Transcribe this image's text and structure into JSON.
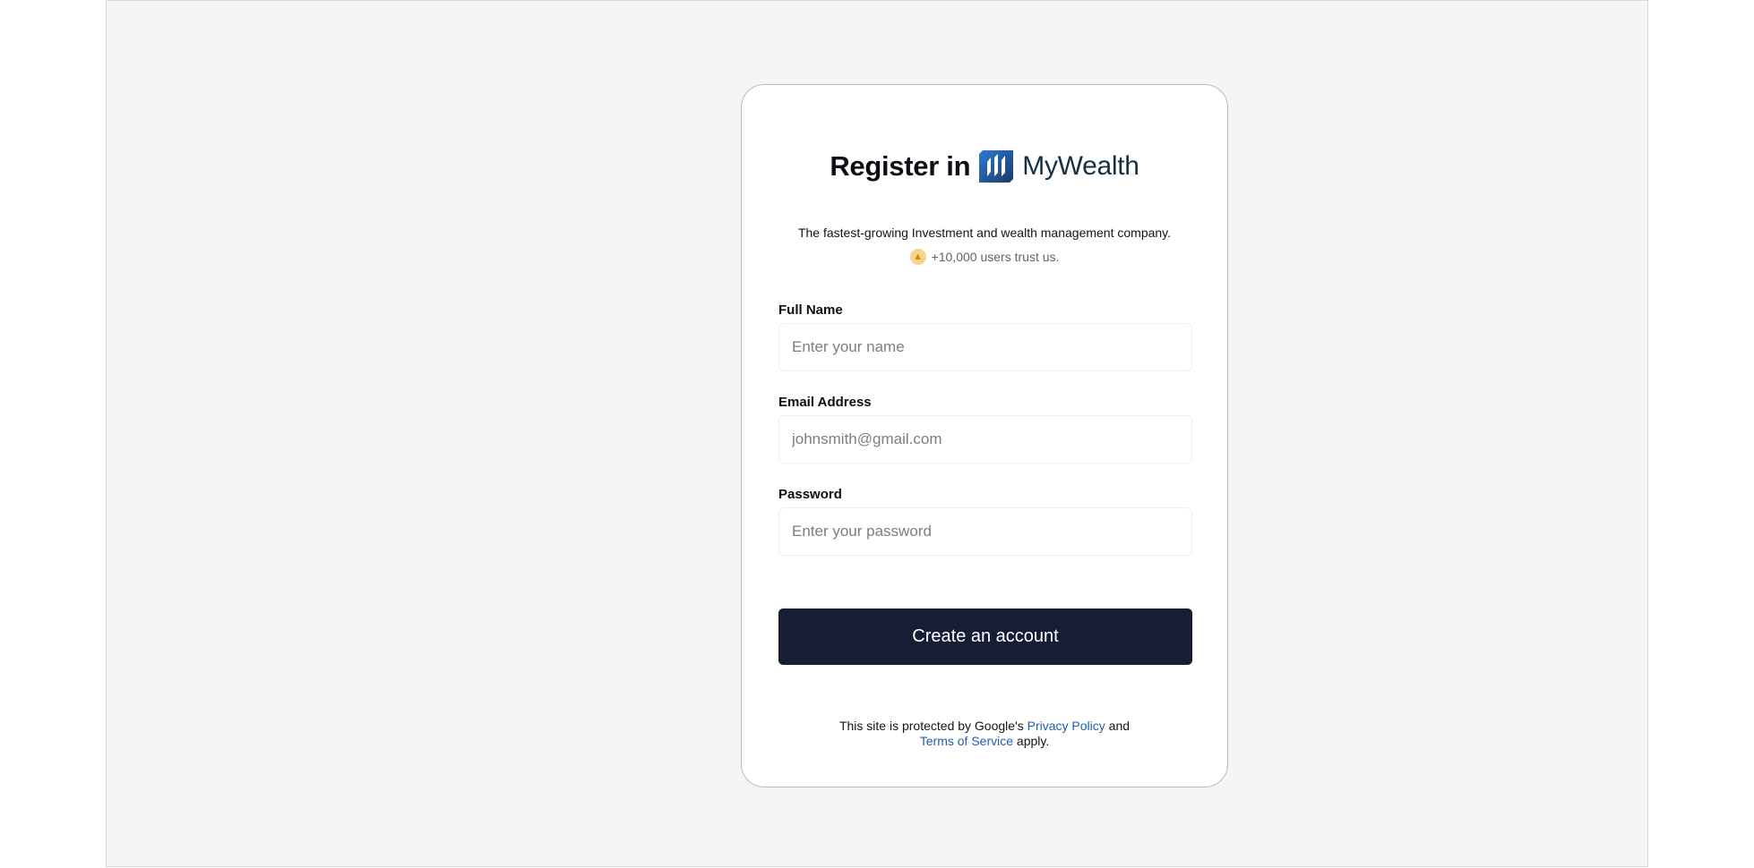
{
  "header": {
    "register_text": "Register in",
    "brand_name": "MyWealth",
    "brand_logo_icon": "mywealth-logo-icon"
  },
  "tagline": "The fastest-growing Investment and wealth management company.",
  "trust": {
    "icon": "thumbs-up-icon",
    "text": "+10,000 users trust us."
  },
  "form": {
    "full_name": {
      "label": "Full Name",
      "placeholder": "Enter your name",
      "value": ""
    },
    "email": {
      "label": "Email Address",
      "placeholder": "johnsmith@gmail.com",
      "value": ""
    },
    "password": {
      "label": "Password",
      "placeholder": "Enter your password",
      "value": ""
    },
    "submit_label": "Create an account"
  },
  "legal": {
    "prefix": "This site is protected by Google's",
    "privacy_link": "Privacy Policy",
    "and_text": "and",
    "terms_link": "Terms of Service",
    "suffix": "apply."
  },
  "colors": {
    "background": "#f5f5f7",
    "card": "#ffffff",
    "button": "#161d35",
    "brand_text": "#163044",
    "link": "#1f5fae"
  }
}
